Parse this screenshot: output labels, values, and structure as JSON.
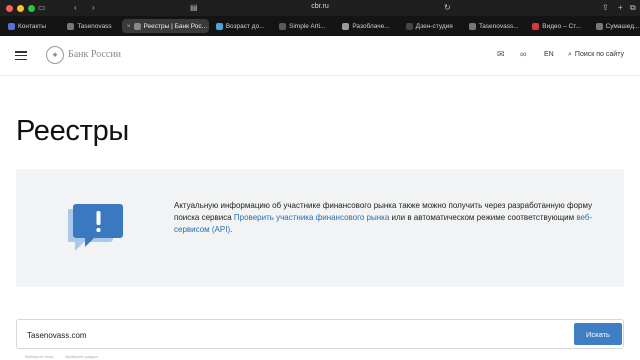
{
  "browser": {
    "url": "cbr.ru",
    "tabs": [
      {
        "label": "Контакты",
        "color": "#5b6fd6"
      },
      {
        "label": "Tasenovass",
        "color": "#777777"
      },
      {
        "label": "Реестры | Банк Рос...",
        "color": "#888888",
        "active": true
      },
      {
        "label": "Возраст до...",
        "color": "#4aa3df"
      },
      {
        "label": "Simple Arti...",
        "color": "#5a5a5a"
      },
      {
        "label": "Разоблаче...",
        "color": "#9b9b9b"
      },
      {
        "label": "Дзен-студия",
        "color": "#444444"
      },
      {
        "label": "Tasenovass...",
        "color": "#777777"
      },
      {
        "label": "Видео – Ст...",
        "color": "#d9363e"
      },
      {
        "label": "Сумашед...",
        "color": "#777777"
      }
    ]
  },
  "header": {
    "logo_text": "Банк России",
    "lang": "EN",
    "search_label": "Поиск по сайту"
  },
  "page": {
    "title": "Реестры",
    "info_before_link": "Актуальную информацию об участнике финансового рынка также можно получить через разработанную форму поиска сервиса ",
    "info_link1": "Проверить участника финансового рынка",
    "info_middle": " или в автоматическом режиме соответствующим ",
    "info_link2": "веб-сервисом (API)",
    "info_end": "."
  },
  "search": {
    "value": "Tasenovass.com",
    "button_label": "Искать",
    "hint1": "Выберите тему",
    "hint2": "Выберите раздел"
  },
  "colors": {
    "accent": "#3d7fc2",
    "link": "#2a6db3",
    "icon_blue": "#3a78bf"
  }
}
